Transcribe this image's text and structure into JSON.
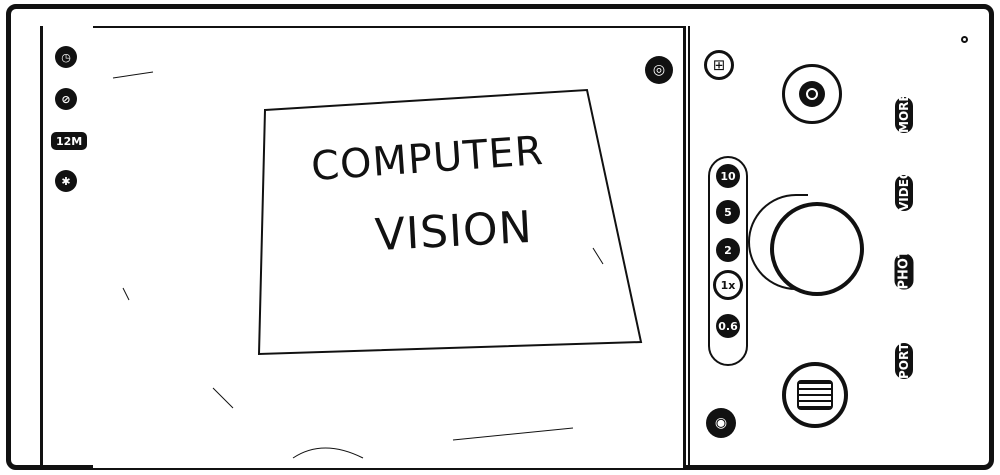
{
  "left_rail": {
    "timer_icon": "timer-icon",
    "flash_icon": "flash-off-icon",
    "resolution": "12M",
    "settings_icon": "settings-icon"
  },
  "viewfinder": {
    "paper_line1": "COMPUTER",
    "paper_line2": "VISION",
    "lens_switch_icon": "lens-switch-icon"
  },
  "controls": {
    "zoom_levels": [
      "10",
      "5",
      "2",
      "1x",
      "0.6"
    ],
    "active_zoom": "1x",
    "modes": [
      "MORE",
      "VIDEO",
      "PHOTO",
      "PORTRAIT"
    ],
    "active_mode": "PHOTO"
  }
}
